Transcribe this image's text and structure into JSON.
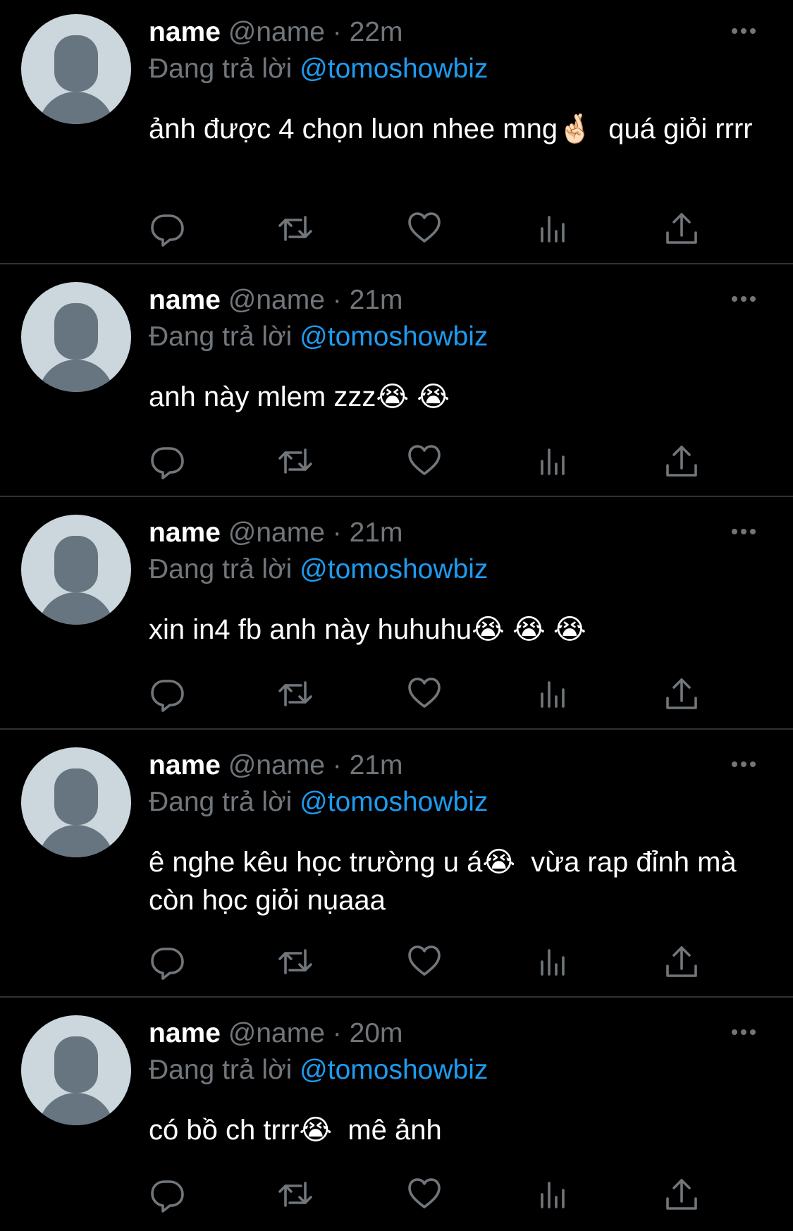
{
  "tweets": [
    {
      "name": "name",
      "handle": "@name",
      "separator": "·",
      "time": "22m",
      "reply_prefix": "Đang trả lời",
      "reply_to": "@tomoshowbiz",
      "text": "ảnh được 4 chọn luon nhee mng🤞🏻  quá giỏi rrrr"
    },
    {
      "name": "name",
      "handle": "@name",
      "separator": "·",
      "time": "21m",
      "reply_prefix": "Đang trả lời",
      "reply_to": "@tomoshowbiz",
      "text": "anh này mlem zzz😭 😭"
    },
    {
      "name": "name",
      "handle": "@name",
      "separator": "·",
      "time": "21m",
      "reply_prefix": "Đang trả lời",
      "reply_to": "@tomoshowbiz",
      "text": "xin in4 fb anh này huhuhu😭 😭 😭"
    },
    {
      "name": "name",
      "handle": "@name",
      "separator": "·",
      "time": "21m",
      "reply_prefix": "Đang trả lời",
      "reply_to": "@tomoshowbiz",
      "text": "ê nghe kêu học trường u á😭  vừa rap đỉnh mà còn học giỏi nụaaa"
    },
    {
      "name": "name",
      "handle": "@name",
      "separator": "·",
      "time": "20m",
      "reply_prefix": "Đang trả lời",
      "reply_to": "@tomoshowbiz",
      "text": "có bồ ch trrr😭  mê ảnh"
    }
  ],
  "icons": {
    "reply": "reply-icon",
    "retweet": "retweet-icon",
    "like": "heart-icon",
    "views": "views-icon",
    "share": "share-icon",
    "more": "more-icon"
  },
  "colors": {
    "background": "#000000",
    "text": "#ffffff",
    "secondary": "#71767b",
    "accent": "#1d9bf0",
    "divider": "#2f3336",
    "avatar_bg": "#ccd6dd",
    "avatar_fg": "#66757f"
  }
}
